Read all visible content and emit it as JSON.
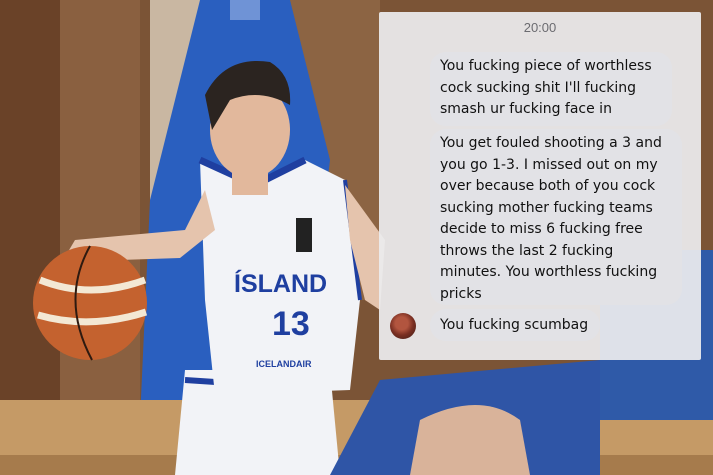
{
  "photo": {
    "jersey_name": "ÍSLAND",
    "jersey_number": "13",
    "sponsor": "ICELANDAIR",
    "colors": {
      "jersey": "#f2f3f7",
      "trim": "#1f3fa0",
      "court_blue": "#2556b0",
      "floor": "#c79a63"
    }
  },
  "chat": {
    "time": "20:00",
    "messages": [
      {
        "text": "You fucking piece of worthless\ncock sucking shit I'll fucking\nsmash ur fucking face in"
      },
      {
        "text": "You get fouled shooting a 3 and\nyou go 1-3. I missed out on my\nover because both of you cock\nsucking mother fucking teams\ndecide to miss 6 fucking free\nthrows the last 2 fucking\nminutes. You worthless fucking\npricks"
      },
      {
        "text": "You fucking scumbag"
      }
    ]
  }
}
